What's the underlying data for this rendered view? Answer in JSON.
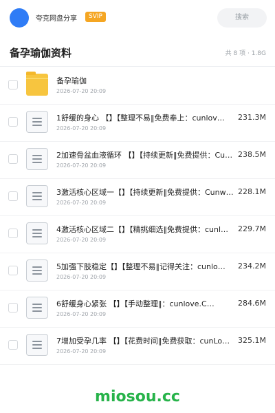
{
  "header": {
    "brand": "夸克网盘分享",
    "badge": "SVIP",
    "search_placeholder": "搜索"
  },
  "folder": {
    "title": "备孕瑜伽资料",
    "meta": "共 8 项 · 1.8G"
  },
  "items": [
    {
      "name": "备孕瑜伽",
      "date": "2026-07-20 20:09",
      "size": "",
      "icon": "folder-icon"
    },
    {
      "name": "1舒缓的身心 【】【整理不易‖免费奉上：cunlov…",
      "date": "2026-07-20 20:09",
      "size": "231.3M",
      "icon": "document-icon"
    },
    {
      "name": "2加速骨盆血液循环 【】【持续更新‖免费提供：Cun…",
      "date": "2026-07-20 20:09",
      "size": "238.5M",
      "icon": "document-icon"
    },
    {
      "name": "3激活核心区域一【】【持续更新‖免费提供：Cunw…",
      "date": "2026-07-20 20:09",
      "size": "228.1M",
      "icon": "document-icon"
    },
    {
      "name": "4激活核心区域二【】【精挑细选‖免费提供：cunl…",
      "date": "2026-07-20 20:09",
      "size": "229.7M",
      "icon": "document-icon"
    },
    {
      "name": "5加强下肢稳定【】【整理不易‖记得关注：cunlo…",
      "date": "2026-07-20 20:09",
      "size": "234.2M",
      "icon": "document-icon"
    },
    {
      "name": "6舒缓身心紧张 【】【手动整理‖：cunlove.C…",
      "date": "2026-07-20 20:09",
      "size": "284.6M",
      "icon": "document-icon"
    },
    {
      "name": "7增加受孕几率 【】【花费时间‖免费获取：cunLo…",
      "date": "2026-07-20 20:09",
      "size": "325.1M",
      "icon": "document-icon"
    }
  ],
  "watermark": "miosou.cc",
  "colors": {
    "accent": "#2f7cf6",
    "badge": "#f5a623",
    "folder": "#f7c53f",
    "watermark": "#27b34a"
  }
}
